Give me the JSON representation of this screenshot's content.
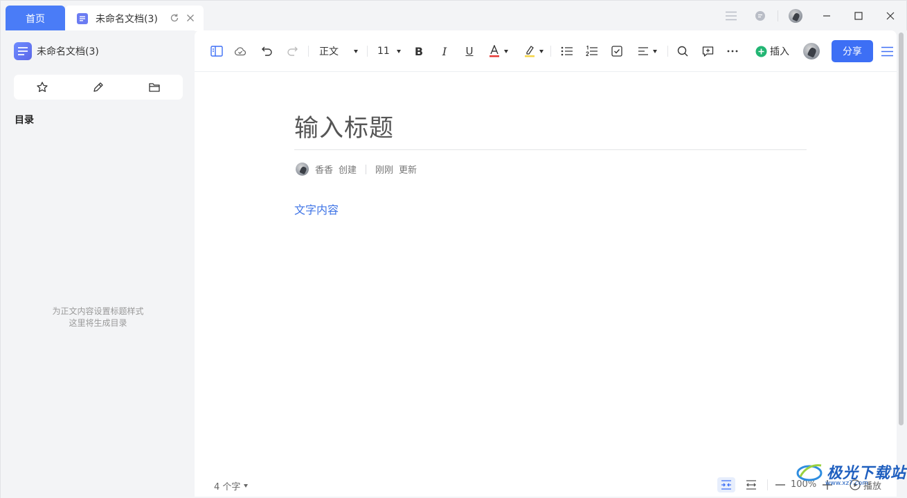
{
  "tabs": {
    "home_label": "首页",
    "doc_label": "未命名文档(3)"
  },
  "sidebar": {
    "doc_title": "未命名文档(3)",
    "tools": [
      "star-icon",
      "pen-icon",
      "folder-icon"
    ],
    "toc_title": "目录",
    "empty_line1": "为正文内容设置标题样式",
    "empty_line2": "这里将生成目录"
  },
  "toolbar": {
    "style_select": "正文",
    "font_size": "11",
    "bold": "B",
    "italic": "I",
    "underline": "U",
    "insert_label": "插入",
    "share_label": "分享"
  },
  "document": {
    "title_placeholder": "输入标题",
    "creator": "香香",
    "created_label": "创建",
    "updated_time": "刚刚",
    "updated_label": "更新",
    "body_text": "文字内容"
  },
  "status": {
    "word_count": "4 个字",
    "zoom": "100%",
    "play_label": "播放"
  },
  "watermark": {
    "text": "极光下载站",
    "sub": "www.xz7.com"
  },
  "colors": {
    "accent": "#3d6ff5",
    "home_tab": "#4a7cf7",
    "link_text": "#3d73e6",
    "insert_green": "#22b573"
  }
}
